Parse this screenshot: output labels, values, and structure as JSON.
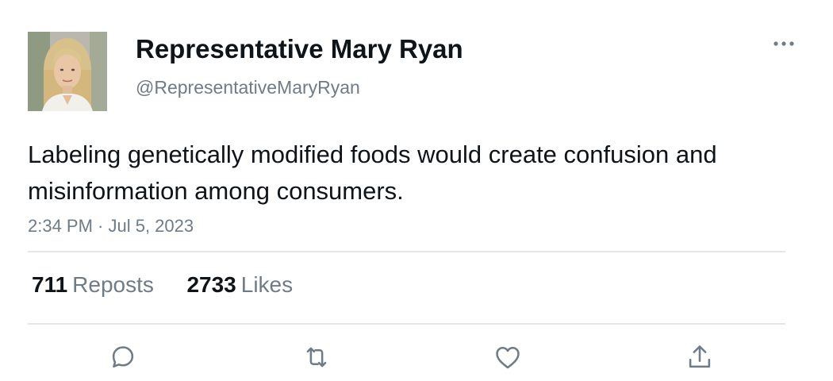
{
  "author": {
    "display_name": "Representative Mary Ryan",
    "handle": "@RepresentativeMaryRyan",
    "avatar": "profile-photo"
  },
  "tweet": {
    "text": "Labeling genetically modified foods would create confusion and misinformation among consumers.",
    "timestamp": "2:34 PM · Jul 5, 2023"
  },
  "stats": {
    "reposts_count": "711",
    "reposts_label": "Reposts",
    "likes_count": "2733",
    "likes_label": "Likes"
  },
  "actions": {
    "reply_icon": "reply-icon",
    "repost_icon": "repost-icon",
    "like_icon": "heart-icon",
    "share_icon": "share-icon",
    "more_icon": "more-options-icon"
  },
  "colors": {
    "primary_text": "#0f1419",
    "secondary_text": "#6f7b86",
    "divider": "#e3e6e8",
    "background": "#ffffff"
  }
}
